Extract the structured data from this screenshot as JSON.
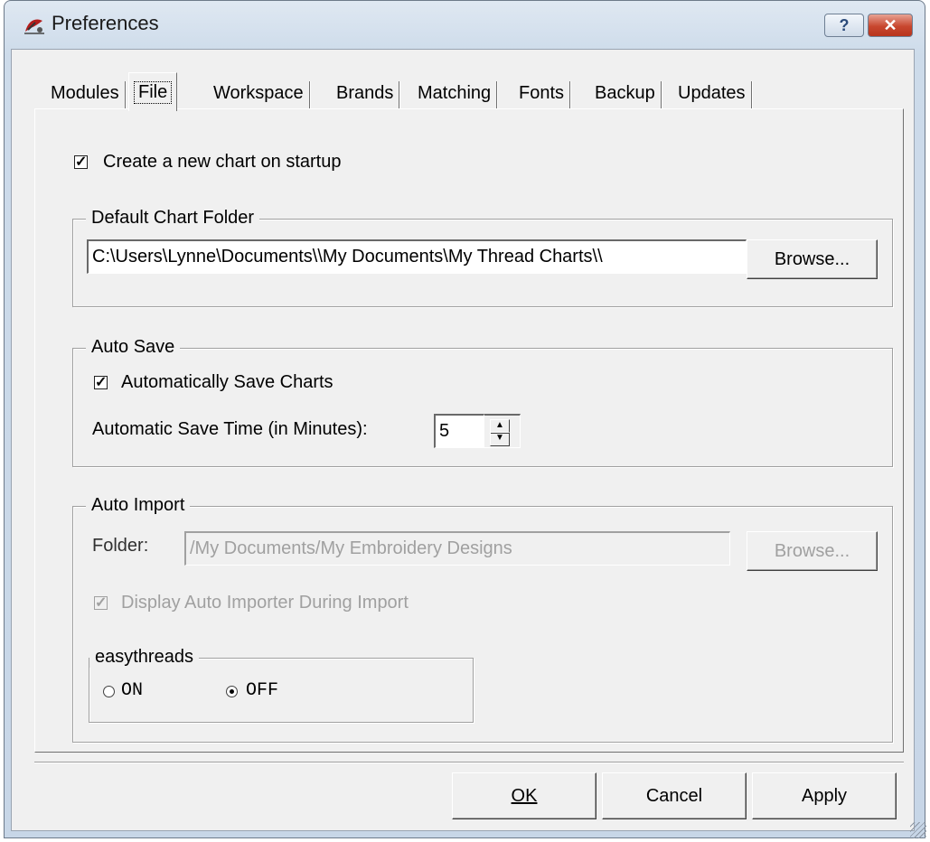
{
  "window": {
    "title": "Preferences",
    "help_label": "?",
    "close_label": "✕",
    "app_icon": "app-logo-icon"
  },
  "tabs": [
    {
      "label": "Modules"
    },
    {
      "label": "File"
    },
    {
      "label": "Workspace"
    },
    {
      "label": "Brands"
    },
    {
      "label": "Matching"
    },
    {
      "label": "Fonts"
    },
    {
      "label": "Backup"
    },
    {
      "label": "Updates"
    }
  ],
  "active_tab": "File",
  "file": {
    "create_new_chart": {
      "label": "Create a new chart on startup",
      "checked": true
    },
    "default_chart_folder": {
      "title": "Default Chart Folder",
      "path": "C:\\Users\\Lynne\\Documents\\\\My Documents\\My Thread Charts\\\\",
      "browse_label": "Browse..."
    },
    "auto_save": {
      "title": "Auto Save",
      "auto_save_label": "Automatically Save Charts",
      "auto_save_checked": true,
      "time_label": "Automatic Save Time (in Minutes):",
      "time_value": "5"
    },
    "auto_import": {
      "title": "Auto Import",
      "folder_label": "Folder:",
      "folder_path": "/My Documents/My Embroidery Designs",
      "browse_label": "Browse...",
      "display_label": "Display Auto Importer During Import",
      "display_checked": true,
      "easythreads": {
        "title": "easythreads",
        "on_label": "ON",
        "off_label": "OFF",
        "selected": "OFF"
      }
    }
  },
  "footer": {
    "ok_label": "OK",
    "cancel_label": "Cancel",
    "apply_label": "Apply"
  }
}
